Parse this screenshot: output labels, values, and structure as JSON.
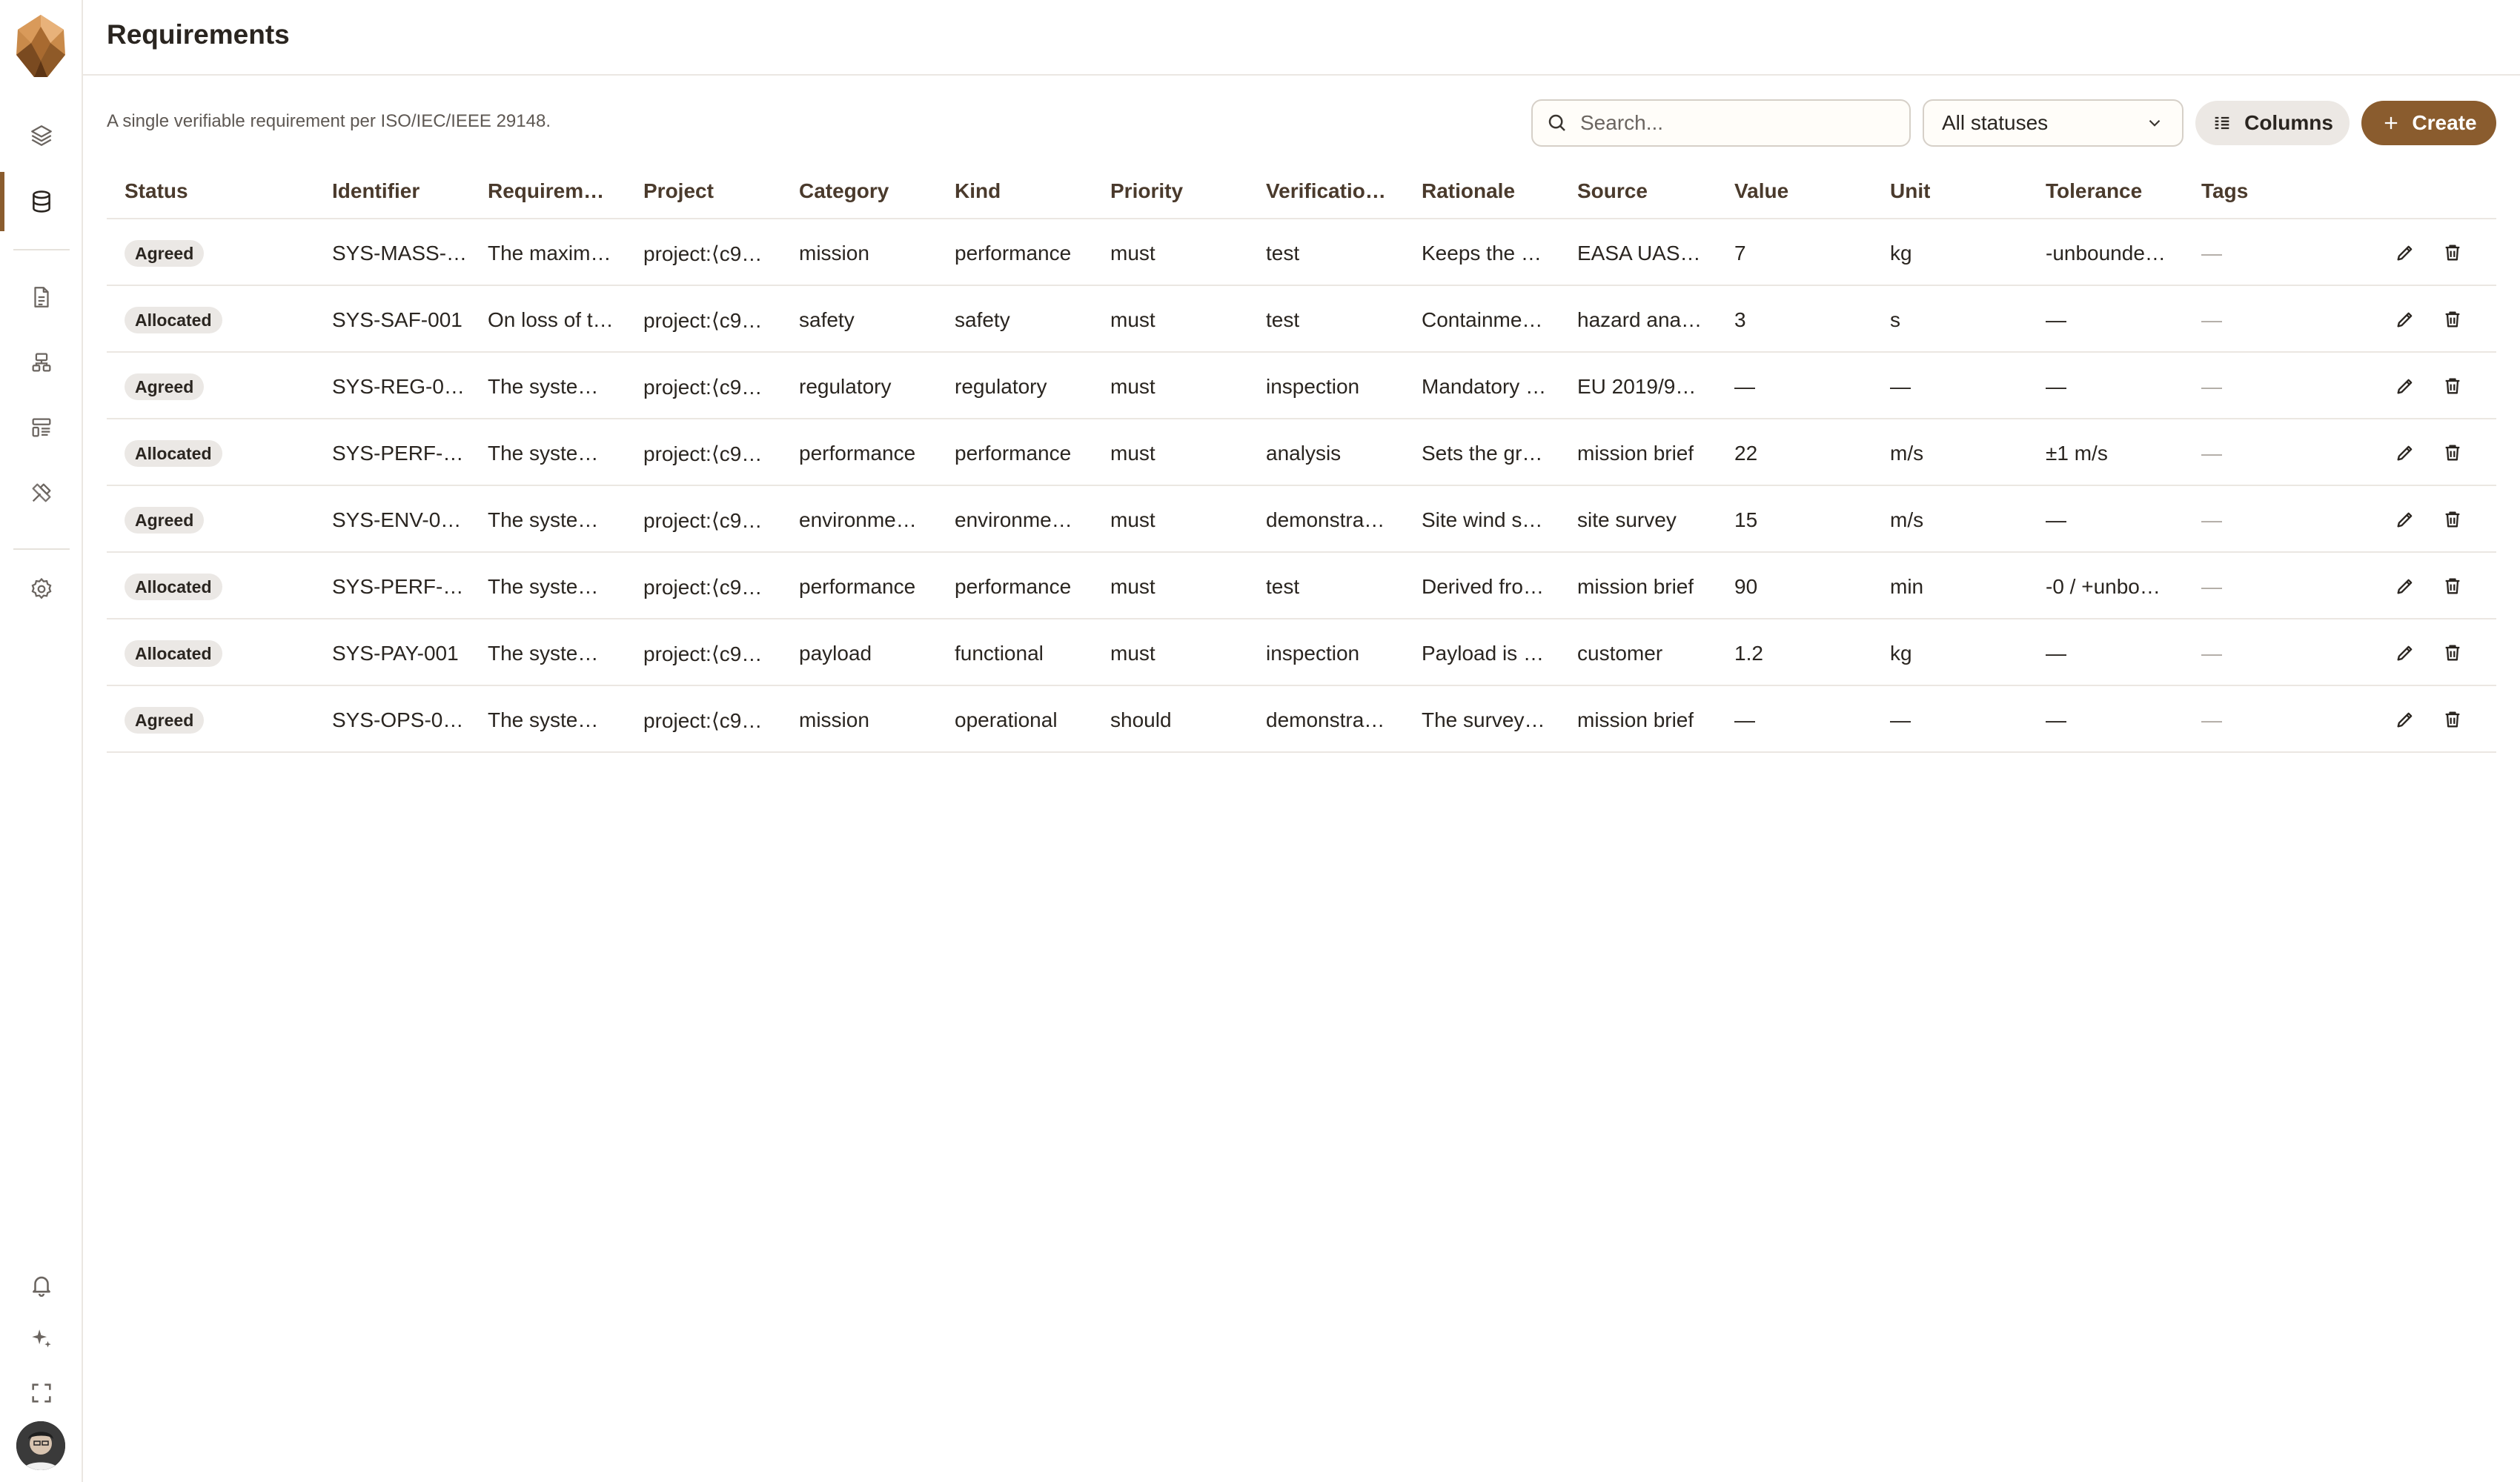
{
  "app": {
    "page_title": "Requirements",
    "subtitle": "A single verifiable requirement per ISO/IEC/IEEE 29148."
  },
  "toolbar": {
    "search_placeholder": "Search...",
    "status_filter": "All statuses",
    "columns_label": "Columns",
    "create_label": "Create"
  },
  "sidebar": {
    "top_items": [
      {
        "name": "layers",
        "icon": "layers-icon"
      },
      {
        "name": "database",
        "icon": "database-icon",
        "active": true
      },
      {
        "name": "documents",
        "icon": "document-icon"
      },
      {
        "name": "hierarchy",
        "icon": "hierarchy-icon"
      },
      {
        "name": "list",
        "icon": "list-icon"
      },
      {
        "name": "tools",
        "icon": "tools-icon"
      },
      {
        "name": "settings",
        "icon": "gear-icon"
      }
    ],
    "bottom_items": [
      {
        "name": "notifications",
        "icon": "bell-icon"
      },
      {
        "name": "ai",
        "icon": "sparkle-icon"
      },
      {
        "name": "fullscreen",
        "icon": "expand-icon"
      }
    ]
  },
  "table": {
    "columns": [
      "Status",
      "Identifier",
      "Requireme…",
      "Project",
      "Category",
      "Kind",
      "Priority",
      "Verificatio…",
      "Rationale",
      "Source",
      "Value",
      "Unit",
      "Tolerance",
      "Tags"
    ],
    "rows": [
      {
        "status": "Agreed",
        "identifier": "SYS-MASS-…",
        "requirement": "The maxim…",
        "project": "project:⟨c9…",
        "category": "mission",
        "kind": "performance",
        "priority": "must",
        "verification": "test",
        "rationale": "Keeps the a…",
        "source": "EASA UAS …",
        "value": "7",
        "unit": "kg",
        "tolerance": "-unbounde…",
        "tags": "—"
      },
      {
        "status": "Allocated",
        "identifier": "SYS-SAF-001",
        "requirement": "On loss of t…",
        "project": "project:⟨c9…",
        "category": "safety",
        "kind": "safety",
        "priority": "must",
        "verification": "test",
        "rationale": "Containme…",
        "source": "hazard ana…",
        "value": "3",
        "unit": "s",
        "tolerance": "—",
        "tags": "—"
      },
      {
        "status": "Agreed",
        "identifier": "SYS-REG-0…",
        "requirement": "The system…",
        "project": "project:⟨c9…",
        "category": "regulatory",
        "kind": "regulatory",
        "priority": "must",
        "verification": "inspection",
        "rationale": "Mandatory …",
        "source": "EU 2019/9…",
        "value": "—",
        "unit": "—",
        "tolerance": "—",
        "tags": "—"
      },
      {
        "status": "Allocated",
        "identifier": "SYS-PERF-…",
        "requirement": "The system…",
        "project": "project:⟨c9…",
        "category": "performance",
        "kind": "performance",
        "priority": "must",
        "verification": "analysis",
        "rationale": "Sets the gr…",
        "source": "mission brief",
        "value": "22",
        "unit": "m/s",
        "tolerance": "±1 m/s",
        "tags": "—"
      },
      {
        "status": "Agreed",
        "identifier": "SYS-ENV-0…",
        "requirement": "The system…",
        "project": "project:⟨c9…",
        "category": "environme…",
        "kind": "environme…",
        "priority": "must",
        "verification": "demonstra…",
        "rationale": "Site wind st…",
        "source": "site survey",
        "value": "15",
        "unit": "m/s",
        "tolerance": "—",
        "tags": "—"
      },
      {
        "status": "Allocated",
        "identifier": "SYS-PERF-…",
        "requirement": "The system…",
        "project": "project:⟨c9…",
        "category": "performance",
        "kind": "performance",
        "priority": "must",
        "verification": "test",
        "rationale": "Derived fro…",
        "source": "mission brief",
        "value": "90",
        "unit": "min",
        "tolerance": "-0 / +unbou…",
        "tags": "—"
      },
      {
        "status": "Allocated",
        "identifier": "SYS-PAY-001",
        "requirement": "The system…",
        "project": "project:⟨c9…",
        "category": "payload",
        "kind": "functional",
        "priority": "must",
        "verification": "inspection",
        "rationale": "Payload is …",
        "source": "customer",
        "value": "1.2",
        "unit": "kg",
        "tolerance": "—",
        "tags": "—"
      },
      {
        "status": "Agreed",
        "identifier": "SYS-OPS-0…",
        "requirement": "The system…",
        "project": "project:⟨c9…",
        "category": "mission",
        "kind": "operational",
        "priority": "should",
        "verification": "demonstra…",
        "rationale": "The survey …",
        "source": "mission brief",
        "value": "—",
        "unit": "—",
        "tolerance": "—",
        "tags": "—"
      }
    ]
  },
  "colors": {
    "accent": "#8a5c2e",
    "badge_bg": "#ebe8e5",
    "border": "#ebe7e2"
  }
}
